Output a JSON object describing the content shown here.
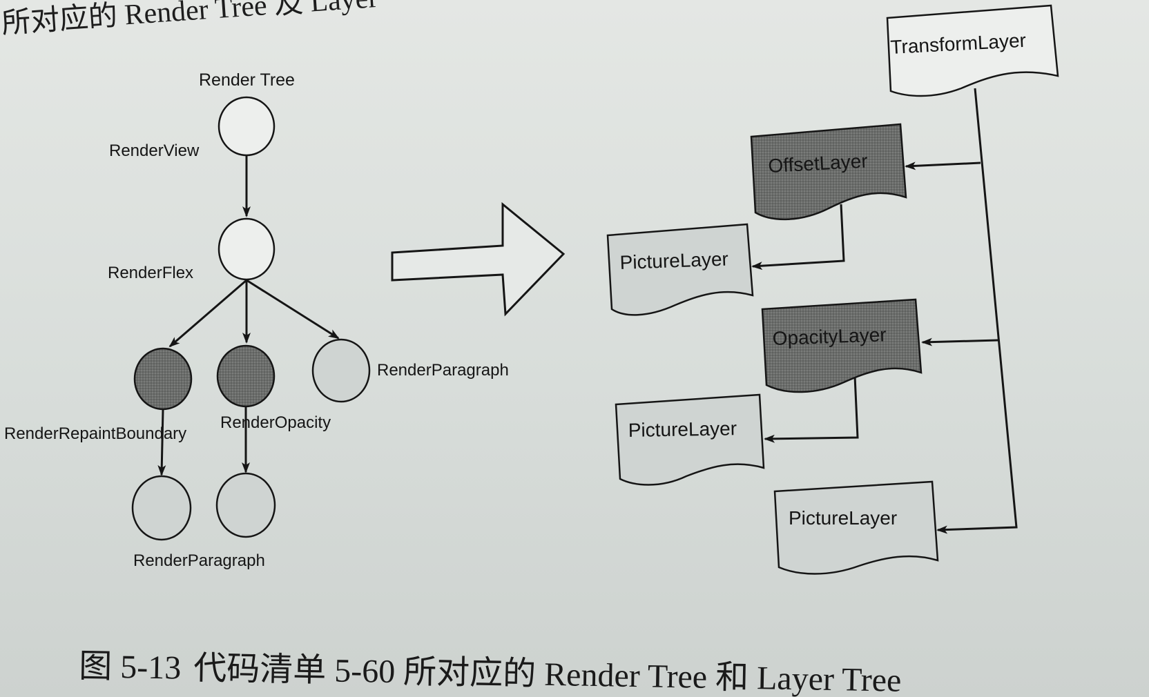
{
  "heading": "所对应的 Render Tree 及 Layer",
  "render_tree": {
    "title": "Render Tree",
    "nodes": [
      {
        "id": "render-view",
        "label": "RenderView",
        "style": "plain"
      },
      {
        "id": "render-flex",
        "label": "RenderFlex",
        "style": "plain"
      },
      {
        "id": "render-repaint-boundary",
        "label": "RenderRepaintBoundary",
        "style": "dark"
      },
      {
        "id": "render-opacity",
        "label": "RenderOpacity",
        "style": "dark"
      },
      {
        "id": "render-paragraph-top",
        "label": "RenderParagraph",
        "style": "light"
      },
      {
        "id": "render-paragraph-bottom-left",
        "label": "RenderParagraph",
        "style": "light"
      },
      {
        "id": "render-paragraph-bottom-right",
        "label": "",
        "style": "light"
      }
    ]
  },
  "layer_tree": {
    "layers": [
      {
        "id": "transform-layer",
        "label": "TransformLayer",
        "style": "plain"
      },
      {
        "id": "offset-layer",
        "label": "OffsetLayer",
        "style": "dark"
      },
      {
        "id": "picture-layer-1",
        "label": "PictureLayer",
        "style": "light"
      },
      {
        "id": "opacity-layer",
        "label": "OpacityLayer",
        "style": "dark"
      },
      {
        "id": "picture-layer-2",
        "label": "PictureLayer",
        "style": "light"
      },
      {
        "id": "picture-layer-3",
        "label": "PictureLayer",
        "style": "light"
      }
    ]
  },
  "caption": {
    "figure_number": "图 5-13",
    "text": "代码清单 5-60 所对应的 Render Tree 和 Layer Tree"
  },
  "colors": {
    "plain_fill": "#edefed",
    "light_fill": "#cfd4d2",
    "dark_fill": "#6b6d6b",
    "stroke": "#151515"
  }
}
